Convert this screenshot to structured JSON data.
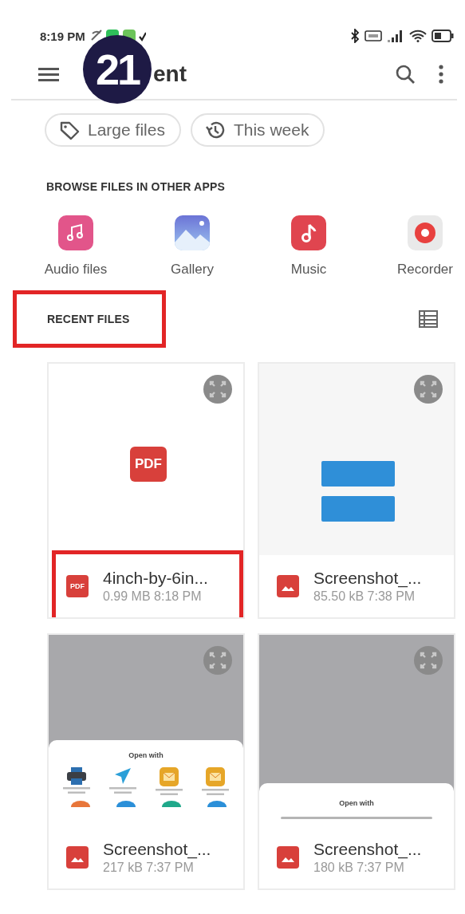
{
  "status_bar": {
    "time": "8:19 PM"
  },
  "tutorial_badge": "21",
  "app_bar": {
    "title": "ent"
  },
  "chips": [
    {
      "label": "Large files",
      "kind": "tag"
    },
    {
      "label": "This week",
      "kind": "history"
    }
  ],
  "browse_section": {
    "heading": "BROWSE FILES IN OTHER APPS",
    "apps": [
      {
        "label": "Audio files",
        "kind": "audio"
      },
      {
        "label": "Gallery",
        "kind": "gallery"
      },
      {
        "label": "Music",
        "kind": "music"
      },
      {
        "label": "Recorder",
        "kind": "recorder"
      }
    ]
  },
  "recent_section": {
    "heading": "RECENT FILES",
    "highlighted": true
  },
  "files": [
    {
      "name": "4inch-by-6in...",
      "meta": "0.99 MB 8:18 PM",
      "kind": "pdf",
      "icon_label": "PDF",
      "highlighted": true,
      "preview": {
        "kind": "pdf",
        "label": "PDF"
      }
    },
    {
      "name": "Screenshot_...",
      "meta": "85.50 kB 7:38 PM",
      "kind": "image",
      "highlighted": false,
      "preview": {
        "kind": "buttons"
      }
    },
    {
      "name": "Screenshot_...",
      "meta": "217 kB 7:37 PM",
      "kind": "image",
      "highlighted": false,
      "preview": {
        "kind": "share_sheet",
        "title": "Open with",
        "targets": [
          {
            "kind": "printer"
          },
          {
            "kind": "send"
          },
          {
            "kind": "mail"
          },
          {
            "kind": "mail"
          }
        ]
      }
    },
    {
      "name": "Screenshot_...",
      "meta": "180 kB 7:37 PM",
      "kind": "image",
      "highlighted": false,
      "preview": {
        "kind": "sheet",
        "title": "Open with"
      }
    }
  ]
}
